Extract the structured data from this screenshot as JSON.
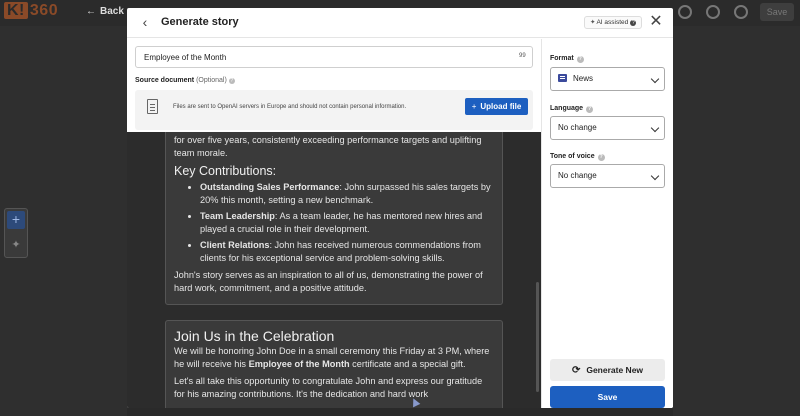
{
  "background": {
    "logo": "360",
    "logo_letter": "K!",
    "back_label": "Back",
    "save_label": "Save"
  },
  "modal": {
    "title": "Generate story",
    "ai_badge": "AI assisted",
    "title_input_value": "Employee of the Month",
    "char_count": "99",
    "source_label": "Source document",
    "source_optional": "(Optional)",
    "upload_note": "Files are sent to OpenAI servers in Europe and should not contain personal information.",
    "upload_button": "Upload file"
  },
  "preview": {
    "card1": {
      "intro": "for over five years, consistently exceeding performance targets and uplifting team morale.",
      "heading": "Key Contributions:",
      "items": [
        {
          "bold": "Outstanding Sales Performance",
          "text": ": John surpassed his sales targets by 20% this month, setting a new benchmark."
        },
        {
          "bold": "Team Leadership",
          "text": ": As a team leader, he has mentored new hires and played a crucial role in their development."
        },
        {
          "bold": "Client Relations",
          "text": ": John has received numerous commendations from clients for his exceptional service and problem-solving skills."
        }
      ],
      "closing": "John's story serves as an inspiration to all of us, demonstrating the power of hard work, commitment, and a positive attitude."
    },
    "card2": {
      "heading": "Join Us in the Celebration",
      "p1_a": "We will be honoring John Doe in a small ceremony this Friday at 3 PM, where he will receive his ",
      "p1_bold": "Employee of the Month",
      "p1_b": " certificate and a special gift.",
      "p2": "Let's all take this opportunity to congratulate John and express our gratitude for his amazing contributions. It's the dedication and hard work"
    }
  },
  "settings": {
    "format_label": "Format",
    "format_value": "News",
    "language_label": "Language",
    "language_value": "No change",
    "tone_label": "Tone of voice",
    "tone_value": "No change",
    "generate_button": "Generate New",
    "save_button": "Save"
  },
  "colors": {
    "primary": "#1d5fc0",
    "preview_bg": "#2c2c2c",
    "card_bg": "#3a3a3a"
  }
}
